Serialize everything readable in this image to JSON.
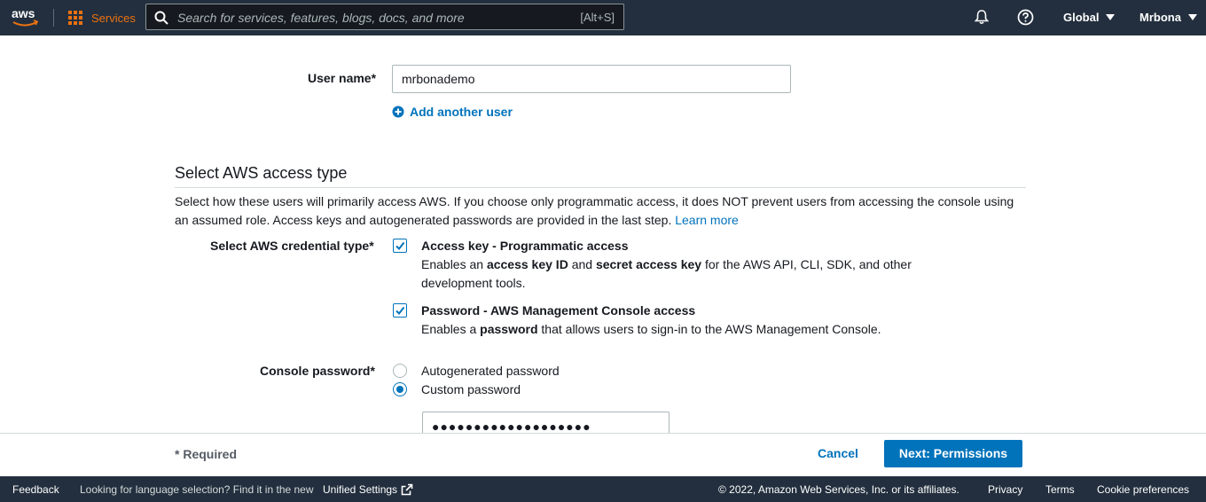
{
  "nav": {
    "logo_text": "aws",
    "services_label": "Services",
    "search_placeholder": "Search for services, features, blogs, docs, and more",
    "search_shortcut": "[Alt+S]",
    "region_label": "Global",
    "account_label": "Mrbona",
    "icons": [
      "aws-logo",
      "services-grid-icon",
      "search-icon",
      "bell-icon",
      "help-icon",
      "caret-down-icon"
    ],
    "accent_color": "#ec7211",
    "background_color": "#232f3e"
  },
  "form": {
    "user_name_label": "User name*",
    "user_name_value": "mrbonademo",
    "add_another_user": "Add another user",
    "section_title": "Select AWS access type",
    "section_desc": "Select how these users will primarily access AWS. If you choose only programmatic access, it does NOT prevent users from accessing the console using an assumed role. Access keys and autogenerated passwords are provided in the last step.",
    "learn_more": "Learn more",
    "credential_label": "Select AWS credential type*",
    "options": [
      {
        "title": "Access key - Programmatic access",
        "desc_parts": [
          "Enables an ",
          "access key ID",
          " and ",
          "secret access key",
          " for the AWS API, CLI, SDK, and other development tools."
        ],
        "checked": true
      },
      {
        "title": "Password - AWS Management Console access",
        "desc_parts": [
          "Enables a ",
          "password",
          " that allows users to sign-in to the AWS Management Console."
        ],
        "checked": true
      }
    ],
    "console_password_label": "Console password*",
    "radio_options": [
      {
        "label": "Autogenerated password",
        "selected": false
      },
      {
        "label": "Custom password",
        "selected": true
      }
    ],
    "password_value": "●●●●●●●●●●●●●●●●●●●",
    "link_color": "#0073bb"
  },
  "actions": {
    "required_note": "* Required",
    "cancel_label": "Cancel",
    "next_label": "Next: Permissions"
  },
  "footer": {
    "feedback": "Feedback",
    "lang_note": "Looking for language selection? Find it in the new",
    "unified_settings": "Unified Settings",
    "copyright": "© 2022, Amazon Web Services, Inc. or its affiliates.",
    "privacy": "Privacy",
    "terms": "Terms",
    "cookies": "Cookie preferences"
  }
}
